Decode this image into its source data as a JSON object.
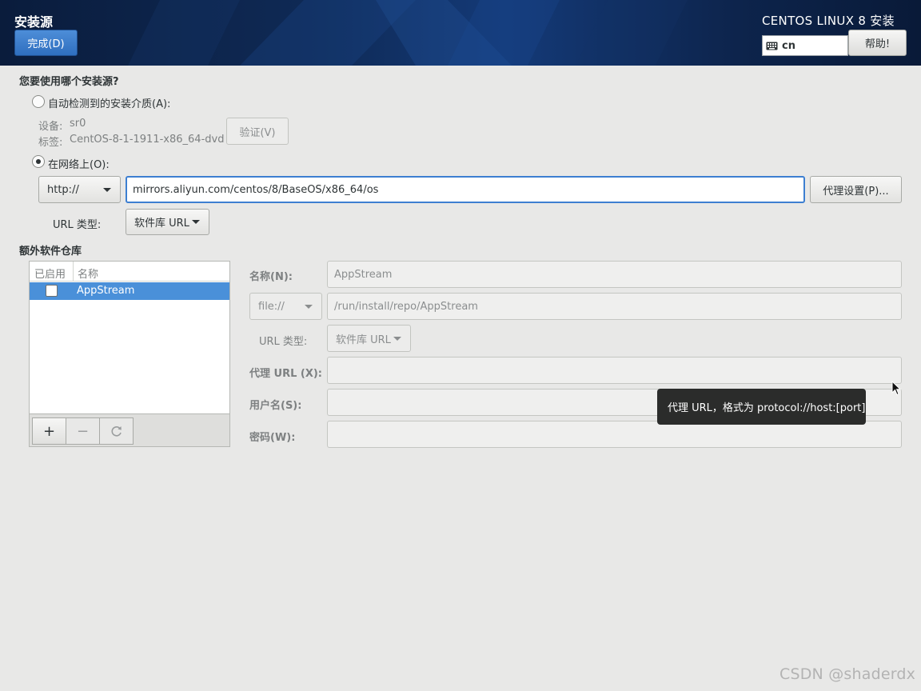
{
  "header": {
    "title": "安装源",
    "done_button": "完成(D)",
    "product": "CENTOS LINUX 8 安装",
    "keyboard_layout": "cn",
    "help_button": "帮助!",
    "keyboard_icon": "keyboard-icon"
  },
  "source": {
    "question": "您要使用哪个安装源?",
    "auto_detect_label": "自动检测到的安装介质(A):",
    "auto_detect_selected": false,
    "device_label": "设备:",
    "device_value": "sr0",
    "tag_label": "标签:",
    "tag_value": "CentOS-8-1-1911-x86_64-dvd",
    "verify_button": "验证(V)",
    "network_label": "在网络上(O):",
    "network_selected": true,
    "protocol": "http://",
    "url": "mirrors.aliyun.com/centos/8/BaseOS/x86_64/os",
    "proxy_button": "代理设置(P)...",
    "url_type_label": "URL 类型:",
    "url_type_value": "软件库 URL"
  },
  "repos": {
    "heading": "额外软件仓库",
    "columns": [
      "已启用",
      "名称"
    ],
    "items": [
      {
        "enabled": false,
        "name": "AppStream",
        "selected": true
      }
    ],
    "toolbar": {
      "add": "+",
      "remove": "−",
      "reset_icon": "refresh-icon"
    }
  },
  "repo_detail": {
    "name_label": "名称(N):",
    "name_value": "AppStream",
    "protocol": "file://",
    "path_value": "/run/install/repo/AppStream",
    "url_type_label": "URL 类型:",
    "url_type_value": "软件库 URL",
    "proxy_label": "代理 URL (X):",
    "proxy_value": "",
    "username_label": "用户名(S):",
    "username_value": "",
    "password_label": "密码(W):",
    "password_value": ""
  },
  "tooltip": "代理 URL，格式为 protocol://host:[port]",
  "watermark": "CSDN @shaderdx",
  "colors": {
    "accent": "#4a90d9",
    "header_bg": "#0f2a56",
    "page_bg": "#e8e8e7"
  }
}
